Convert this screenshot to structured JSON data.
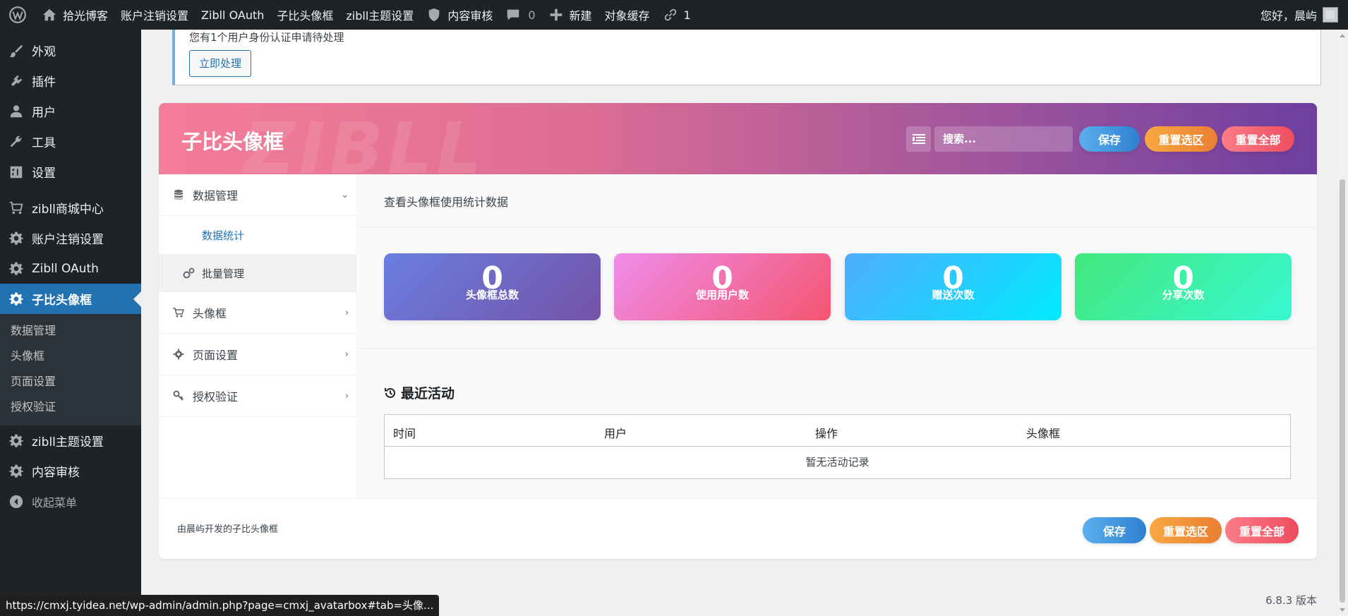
{
  "admin_bar": {
    "site_name": "拾光博客",
    "items": [
      "账户注销设置",
      "Zibll OAuth",
      "子比头像框",
      "zibll主题设置"
    ],
    "review_label": "内容审核",
    "comments_count": "0",
    "new_label": "新建",
    "cache_label": "对象缓存",
    "links_count": "1",
    "greeting": "您好，晨屿"
  },
  "sidebar": {
    "top_items": [
      "外观",
      "插件",
      "用户",
      "工具",
      "设置"
    ],
    "mid_items": [
      "zibll商城中心",
      "账户注销设置",
      "Zibll OAuth"
    ],
    "active_item": "子比头像框",
    "submenu": [
      "数据管理",
      "头像框",
      "页面设置",
      "授权验证"
    ],
    "bottom_items": [
      "zibll主题设置",
      "内容审核"
    ],
    "collapse_label": "收起菜单"
  },
  "notice": {
    "text": "您有1个用户身份认证申请待处理",
    "button": "立即处理"
  },
  "panel": {
    "title": "子比头像框",
    "watermark": "ZIBLL",
    "search_placeholder": "搜索...",
    "save": "保存",
    "reset_section": "重置选区",
    "reset_all": "重置全部",
    "nav": {
      "data_manage": "数据管理",
      "data_stats": "数据统计",
      "batch_manage": "批量管理",
      "frame": "头像框",
      "page_settings": "页面设置",
      "auth": "授权验证"
    },
    "content": {
      "description": "查看头像框使用统计数据",
      "stats": [
        {
          "value": "0",
          "label": "头像框总数"
        },
        {
          "value": "0",
          "label": "使用用户数"
        },
        {
          "value": "0",
          "label": "赠送次数"
        },
        {
          "value": "0",
          "label": "分享次数"
        }
      ],
      "activity_title": "最近活动",
      "table_headers": [
        "时间",
        "用户",
        "操作",
        "头像框"
      ],
      "empty_text": "暂无活动记录"
    },
    "footer_text": "由晨屿开发的子比头像框"
  },
  "version": "6.8.3 版本",
  "status_url": "https://cmxj.tyidea.net/wp-admin/admin.php?page=cmxj_avatarbox#tab=头像..."
}
